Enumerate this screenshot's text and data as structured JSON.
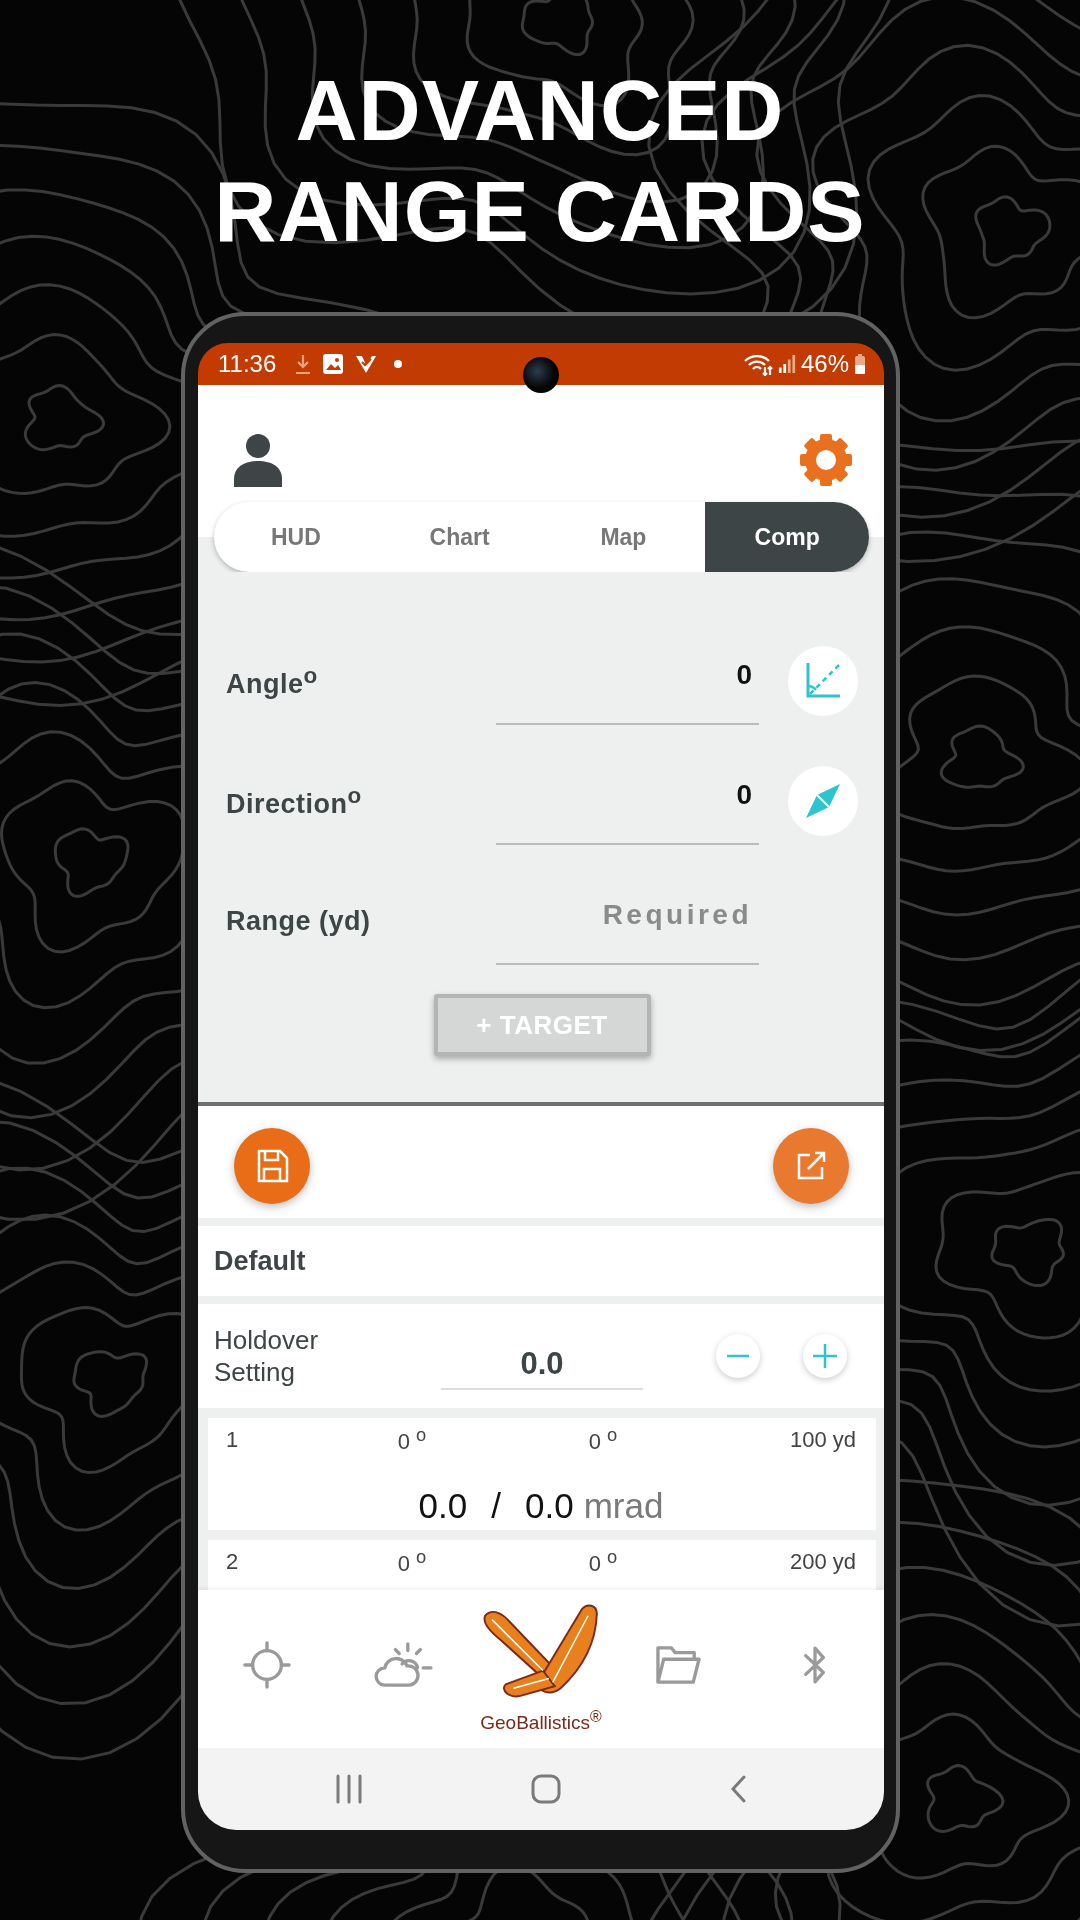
{
  "headline": "ADVANCED RANGE CARDS",
  "status_bar": {
    "time": "11:36",
    "battery": "46%"
  },
  "tabs": [
    {
      "label": "HUD",
      "selected": false
    },
    {
      "label": "Chart",
      "selected": false
    },
    {
      "label": "Map",
      "selected": false
    },
    {
      "label": "Comp",
      "selected": true
    }
  ],
  "inputs": [
    {
      "kind": "angle",
      "label": "Angle$^{o}$",
      "value": "0"
    },
    {
      "kind": "direction",
      "label": "Direction$^{o}$",
      "value": "0"
    },
    {
      "kind": "range",
      "label": "Range (yd)",
      "placeholder": "Required"
    }
  ],
  "target_button": {
    "label": "+ TARGET",
    "disabled": true
  },
  "range_card": {
    "title": "Default",
    "holdover": {
      "label": "Holdover Setting",
      "value": "0.0"
    },
    "rows": [
      {
        "number": "1",
        "angle": "0 $^{o}$",
        "direction": "0 $^{o}$",
        "range": "100 yd",
        "elevation": "0.0",
        "separator": "/",
        "windage": "0.0",
        "unit": "mrad"
      },
      {
        "number": "2",
        "angle": "0 $^{o}$",
        "direction": "0 $^{o}$",
        "range": "200 yd"
      }
    ]
  },
  "bottom_nav": {
    "logo_text": "GeoBallistics$^{®}$"
  }
}
